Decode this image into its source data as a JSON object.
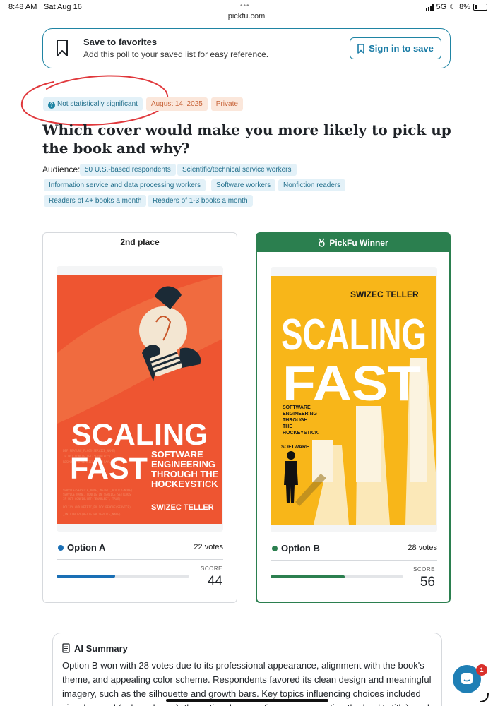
{
  "status": {
    "time": "8:48 AM",
    "date": "Sat Aug 16",
    "url": "pickfu.com",
    "network": "5G",
    "battery": "8%"
  },
  "favorites": {
    "title": "Save to favorites",
    "subtitle": "Add this poll to your saved list for easy reference.",
    "button_label": "Sign in to save"
  },
  "poll": {
    "significance": "Not statistically significant",
    "date": "August 14, 2025",
    "visibility": "Private",
    "question": "Which cover would make you more likely to pick up the book and why?",
    "audience_label": "Audience:",
    "audience": [
      "50 U.S.-based respondents",
      "Scientific/technical service workers",
      "Information service and data processing workers",
      "Software workers",
      "Nonfiction readers",
      "Readers of 4+ books a month",
      "Readers of 1-3 books a month"
    ]
  },
  "options": [
    {
      "header": "2nd place",
      "label": "Option A",
      "votes": "22 votes",
      "score_label": "SCORE",
      "score": "44",
      "score_fraction": 0.44,
      "color": "#1a6fb5",
      "cover": {
        "title_line1": "SCALING",
        "title_line2": "FAST",
        "subtitle_lines": [
          "SOFTWARE",
          "ENGINEERING",
          "THROUGH THE",
          "HOCKEYSTICK"
        ],
        "author": "SWIZEC TELLER",
        "background": "#ee5531"
      }
    },
    {
      "header": "PickFu Winner",
      "label": "Option B",
      "votes": "28 votes",
      "score_label": "SCORE",
      "score": "56",
      "score_fraction": 0.56,
      "color": "#2b7f4f",
      "cover": {
        "author": "SWIZEC TELLER",
        "title_line1": "SCALING",
        "title_line2": "FAST",
        "subtitle_lines": [
          "SOFTWARE",
          "ENGINEERING",
          "THROUGH",
          "THE",
          "HOCKEYSTICK"
        ],
        "background": "#f8b619"
      }
    }
  ],
  "summary": {
    "title": "AI Summary",
    "text": "Option B won with 28 votes due to its professional appearance, alignment with the book's theme, and appealing color scheme. Respondents favored its clean design and meaningful imagery, such as the silhouette and growth bars. Key topics influencing choices included visual appeal (color scheme), thematic relevance (imagery supporting the book's title), and"
  },
  "chat": {
    "badge": "1"
  }
}
